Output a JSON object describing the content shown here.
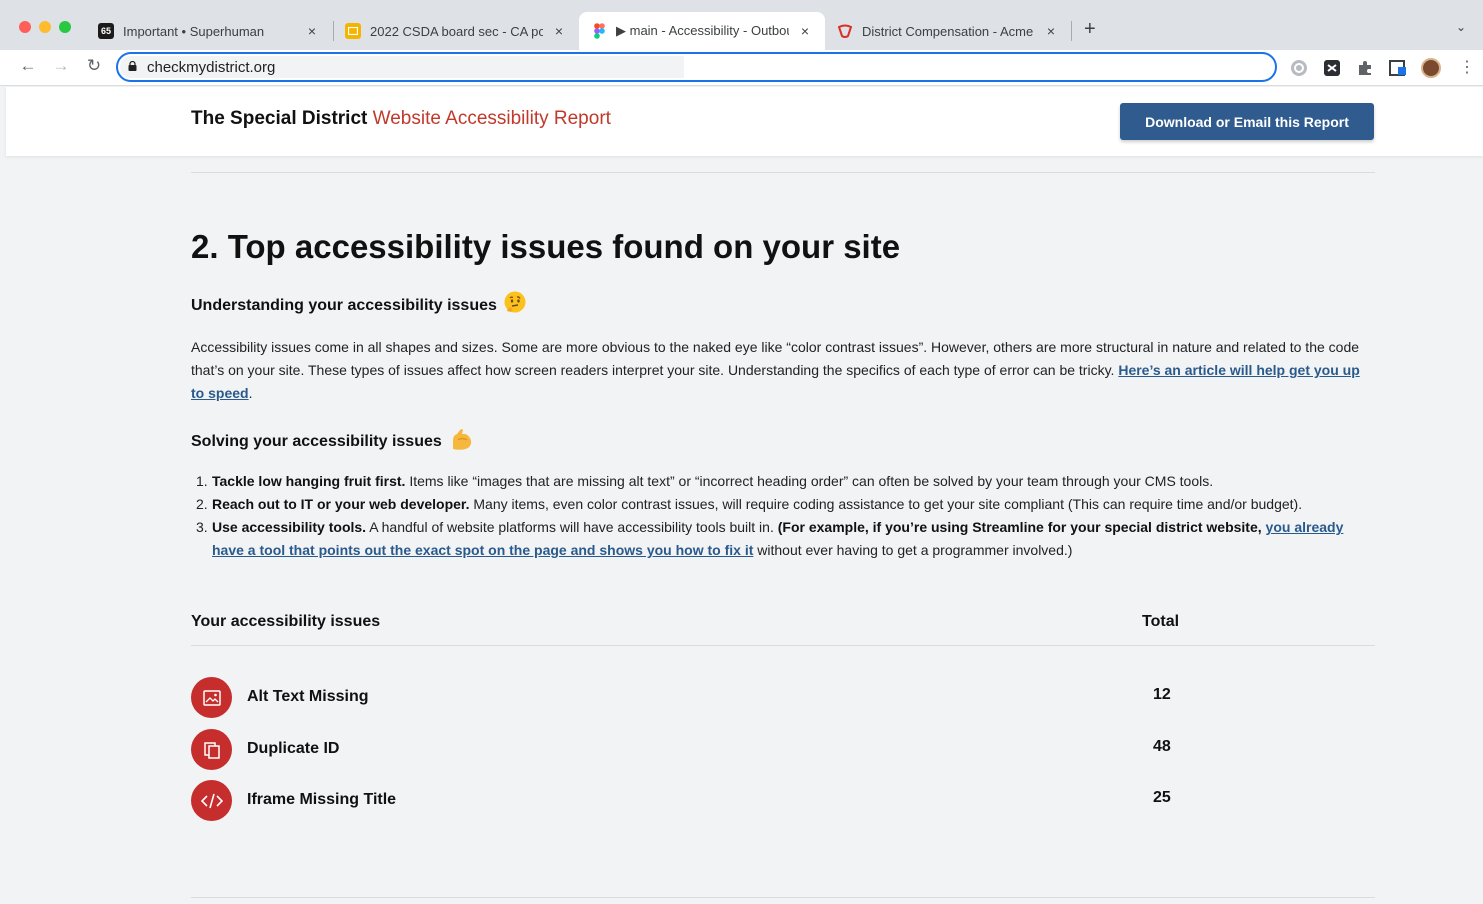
{
  "browser": {
    "tabs": [
      {
        "title": "Important • Superhuman",
        "favicon_text": "65",
        "active": false
      },
      {
        "title": "2022 CSDA board sec - CA po",
        "favicon_text": "",
        "active": false
      },
      {
        "title": "▶ main - Accessibility - Outbou",
        "favicon_text": "",
        "active": true
      },
      {
        "title": "District Compensation - Acme",
        "favicon_text": "",
        "active": false
      }
    ],
    "close_glyph": "×",
    "new_tab_glyph": "+",
    "tab_menu_glyph": "⌄",
    "back_glyph": "←",
    "forward_glyph": "→",
    "reload_glyph": "↻",
    "url": "checkmydistrict.org",
    "menu_glyph": "⋮"
  },
  "header": {
    "brand_strong": "The Special District",
    "brand_accent": "Website Accessibility Report",
    "download_button": "Download or Email this Report"
  },
  "section": {
    "title": "2. Top accessibility issues found on your site",
    "understanding_heading": "Understanding your accessibility issues",
    "understanding_emoji": "🤔",
    "understanding_text": "Accessibility issues come in all shapes and sizes. Some are more obvious to the naked eye like “color contrast issues”. However, others are more structural in nature and related to the code that’s on your site. These types of issues affect how screen readers interpret your site. Understanding the specifics of each type of error can be tricky.",
    "understanding_link": "Here’s an article will help get you up to speed",
    "understanding_end": ".",
    "solving_heading": "Solving your accessibility issues",
    "solving_emoji": "💪",
    "steps": [
      {
        "num": "1.",
        "bold": "Tackle low hanging fruit first.",
        "text": " Items like “images that are missing alt text” or “incorrect heading order” can often be solved by your team through your CMS tools."
      },
      {
        "num": "2.",
        "bold": "Reach out to IT or your web developer.",
        "text": " Many items, even color contrast issues, will require coding assistance to get your site compliant (This can require time and/or budget)."
      },
      {
        "num": "3.",
        "bold": "Use accessibility tools.",
        "text": " A handful of website platforms will have accessibility tools built in. ",
        "bold2": "(For example, if you’re using Streamline for your special district website,",
        "link": "you already have a tool that points out the exact spot on the page and shows you how to fix it",
        "end": " without ever having to get a programmer involved.)"
      }
    ]
  },
  "issues_table": {
    "label_header": "Your accessibility issues",
    "total_header": "Total",
    "rows": [
      {
        "label": "Alt Text Missing",
        "total": "12",
        "icon": "image-icon"
      },
      {
        "label": "Duplicate ID",
        "total": "48",
        "icon": "copy-icon"
      },
      {
        "label": "Iframe Missing Title",
        "total": "25",
        "icon": "code-icon"
      }
    ]
  },
  "colors": {
    "brand_accent": "#c0392b",
    "button": "#2f5b8e",
    "issue_icon": "#c62d2d",
    "link": "#2a5a8c"
  }
}
